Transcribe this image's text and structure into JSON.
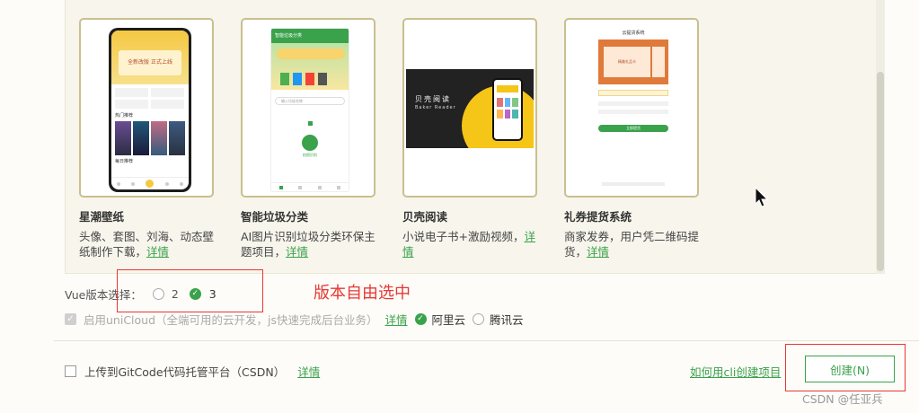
{
  "templates": [
    {
      "title": "星潮壁纸",
      "desc": "头像、套图、刘海、动态壁纸制作下载，",
      "detail": "详情",
      "screen": {
        "banner1": "全新改版 正式上线",
        "section": "热门推荐",
        "section2": "每日推荐"
      }
    },
    {
      "title": "智能垃圾分类",
      "desc": "AI图片识别垃圾分类环保主题项目，",
      "detail": "详情",
      "screen": {
        "header": "智能垃圾分类",
        "search": "输入垃圾名称",
        "camera": "拍照识别"
      }
    },
    {
      "title": "贝壳阅读",
      "desc": "小说电子书+激励视频，",
      "detail": "详情",
      "screen": {
        "title": "贝壳阅读",
        "subtitle": "Baker Reader"
      }
    },
    {
      "title": "礼券提货系统",
      "desc": "商家发券，用户凭二维码提货，",
      "detail": "详情",
      "screen": {
        "header": "云提货系统",
        "coupon": "精美礼品卡",
        "button": "立即提货"
      }
    }
  ],
  "vue": {
    "label": "Vue版本选择：",
    "opt2": "2",
    "opt3": "3",
    "selected": "3"
  },
  "annotation": "版本自由选中",
  "unicloud": {
    "label": "启用uniCloud（全端可用的云开发，js快速完成后台业务）",
    "detail": "详情",
    "aliyun": "阿里云",
    "tencent": "腾讯云"
  },
  "gitcode": {
    "label": "上传到GitCode代码托管平台（CSDN）",
    "detail": "详情"
  },
  "cli_link": "如何用cli创建项目",
  "create_button": "创建(N)",
  "watermark": "CSDN @任亚兵",
  "colors": {
    "accent": "#3aa24b",
    "annotation": "#e53935",
    "card_border": "#c8c08e"
  }
}
